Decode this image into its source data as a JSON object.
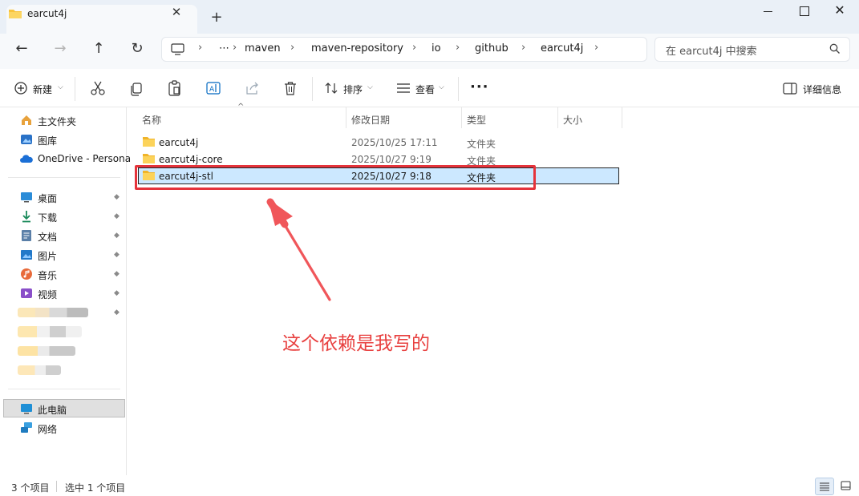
{
  "tab": {
    "title": "earcut4j",
    "close": "✕",
    "new_tab": "+"
  },
  "window": {
    "minimize": "",
    "maximize": "",
    "close": "✕"
  },
  "nav": {
    "back": "←",
    "forward": "→",
    "up": "↑",
    "refresh": "↻"
  },
  "address": {
    "more": "⋯",
    "separator": "›",
    "breadcrumbs": [
      "maven",
      "maven-repository",
      "io",
      "github",
      "earcut4j"
    ]
  },
  "search": {
    "placeholder": "在 earcut4j 中搜索"
  },
  "toolbar": {
    "new_label": "新建",
    "sort_label": "排序",
    "view_label": "查看",
    "more_label": "···",
    "details_label": "详细信息"
  },
  "sidebar": {
    "quick": [
      {
        "label": "主文件夹",
        "icon": "home-icon"
      },
      {
        "label": "图库",
        "icon": "gallery-icon"
      },
      {
        "label": "OneDrive - Persona",
        "icon": "onedrive-icon"
      }
    ],
    "pinned": [
      {
        "label": "桌面",
        "icon": "desktop-icon"
      },
      {
        "label": "下载",
        "icon": "download-icon"
      },
      {
        "label": "文档",
        "icon": "documents-icon"
      },
      {
        "label": "图片",
        "icon": "pictures-icon"
      },
      {
        "label": "音乐",
        "icon": "music-icon"
      },
      {
        "label": "视频",
        "icon": "videos-icon"
      }
    ],
    "pin_glyph": "📌",
    "this_pc": "此电脑",
    "network": "网络"
  },
  "columns": {
    "name": "名称",
    "modified": "修改日期",
    "type": "类型",
    "size": "大小"
  },
  "files": [
    {
      "name": "earcut4j",
      "modified": "2025/10/25 17:11",
      "type": "文件夹",
      "size": ""
    },
    {
      "name": "earcut4j-core",
      "modified": "2025/10/27 9:19",
      "type": "文件夹",
      "size": ""
    },
    {
      "name": "earcut4j-stl",
      "modified": "2025/10/27 9:18",
      "type": "文件夹",
      "size": ""
    }
  ],
  "annotation": {
    "text": "这个依赖是我写的",
    "color": "#e8403f"
  },
  "status": {
    "count": "3 个项目",
    "selected": "选中 1 个项目"
  },
  "colors": {
    "accent": "#0067c0",
    "selection": "#cce8ff",
    "folder": "#f8c33c",
    "annotation_red": "#e5333b"
  }
}
